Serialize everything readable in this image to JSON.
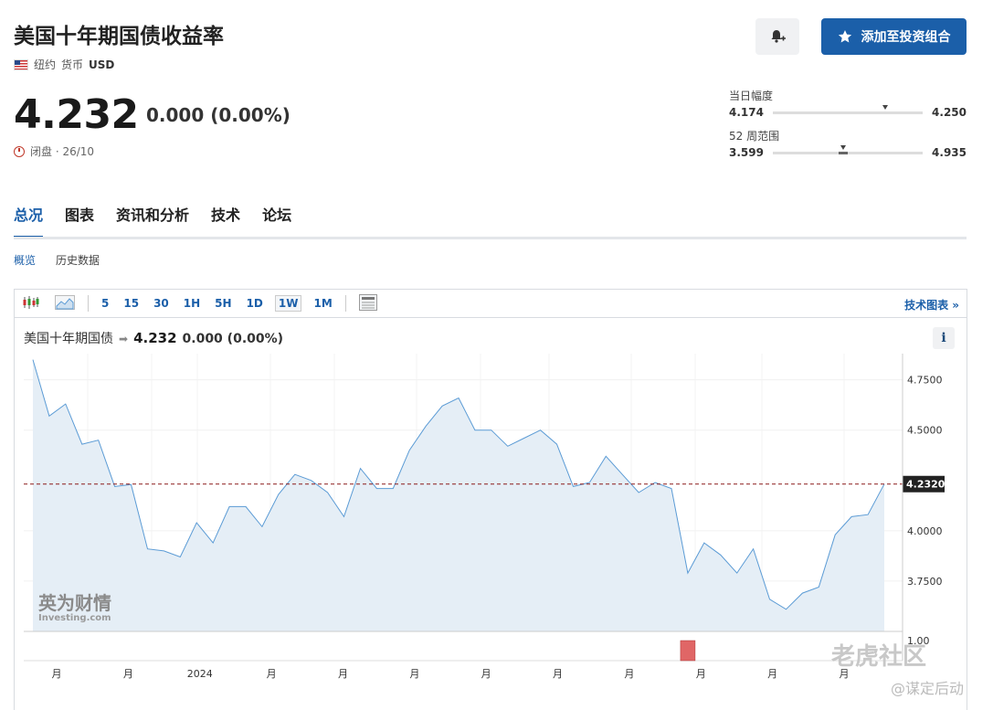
{
  "header": {
    "title": "美国十年期国债收益率",
    "location": "纽约",
    "currency_label": "货币",
    "currency": "USD",
    "price": "4.232",
    "change": "0.000 (0.00%)",
    "status": "闭盘 · 26/10",
    "add_button": "添加至投资组合"
  },
  "ranges": {
    "day_label": "当日幅度",
    "day_low": "4.174",
    "day_high": "4.250",
    "day_position": 0.75,
    "week52_label": "52 周范围",
    "week52_low": "3.599",
    "week52_high": "4.935",
    "week52_position": 0.47
  },
  "tabs": [
    "总况",
    "图表",
    "资讯和分析",
    "技术",
    "论坛"
  ],
  "subtabs": [
    "概览",
    "历史数据"
  ],
  "toolbar": {
    "intervals": [
      "5",
      "15",
      "30",
      "1H",
      "5H",
      "1D",
      "1W",
      "1M"
    ],
    "selected": "1W",
    "right_link": "技术图表 »"
  },
  "chart_header": {
    "name": "美国十年期国债",
    "price": "4.232",
    "change": "0.000 (0.00%)"
  },
  "logo": {
    "cn": "英为财情",
    "en": "Investing.com"
  },
  "watermark": {
    "main": "老虎社区",
    "sub": "@谋定后动"
  },
  "colors": {
    "line": "#5b9bd5",
    "fill": "#e5eef6",
    "ref": "#8b1a1a",
    "volume": "#e06666",
    "accent": "#1b5fa9"
  },
  "chart_data": {
    "type": "area",
    "x_tick_labels": [
      "月",
      "月",
      "2024",
      "月",
      "月",
      "月",
      "月",
      "月",
      "月",
      "月",
      "月",
      "月"
    ],
    "y_ticks": [
      "4.7500",
      "4.5000",
      "4.0000",
      "3.7500"
    ],
    "volume_tick": "1.00",
    "current_label": "4.2320",
    "current_value": 4.232,
    "ylim": [
      3.5,
      4.88
    ],
    "values": [
      4.85,
      4.57,
      4.63,
      4.43,
      4.45,
      4.22,
      4.23,
      3.91,
      3.9,
      3.87,
      4.04,
      3.94,
      4.12,
      4.12,
      4.02,
      4.18,
      4.28,
      4.25,
      4.19,
      4.07,
      4.31,
      4.21,
      4.21,
      4.4,
      4.52,
      4.62,
      4.66,
      4.5,
      4.5,
      4.42,
      4.46,
      4.5,
      4.43,
      4.22,
      4.24,
      4.37,
      4.28,
      4.19,
      4.24,
      4.21,
      3.79,
      3.94,
      3.88,
      3.79,
      3.91,
      3.66,
      3.61,
      3.69,
      3.72,
      3.98,
      4.07,
      4.08,
      4.232
    ],
    "volume_bar_index": 40
  }
}
